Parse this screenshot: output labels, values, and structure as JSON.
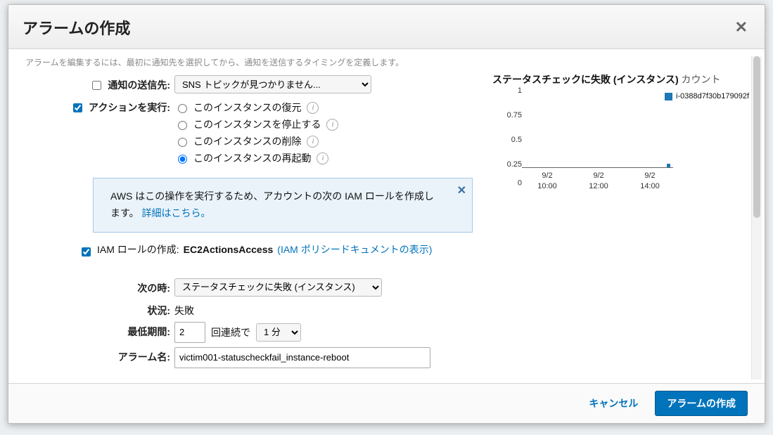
{
  "dialog": {
    "title": "アラームの作成",
    "intro": "アラームを編集するには、最初に通知先を選択してから、通知を送信するタイミングを定義します。"
  },
  "form": {
    "send_label": "通知の送信先:",
    "send_checked": false,
    "send_select": "SNS トピックが見つかりません...",
    "action_label": "アクションを実行:",
    "action_checked": true,
    "action_options": {
      "recover": "このインスタンスの復元",
      "stop": "このインスタンスを停止する",
      "delete": "このインスタンスの削除",
      "reboot": "このインスタンスの再起動"
    },
    "iam_notice": "AWS はこの操作を実行するため、アカウントの次の IAM ロールを作成します。",
    "iam_notice_link": "詳細はこちら。",
    "iam_row_label": "IAM ロールの作成:",
    "iam_role_name": "EC2ActionsAccess",
    "iam_policy_link": "(IAM ポリシードキュメントの表示)",
    "when_label": "次の時:",
    "when_select": "ステータスチェックに失敗 (インスタンス)",
    "status_label": "状況:",
    "status_value": "失敗",
    "min_period_label": "最低期間:",
    "min_period_value": "2",
    "min_period_mid": "回連続で",
    "min_period_select": "1 分",
    "alarm_name_label": "アラーム名:",
    "alarm_name_value": "victim001-statuscheckfail_instance-reboot"
  },
  "chart_data": {
    "type": "bar",
    "title_main": "ステータスチェックに失敗 (インスタンス)",
    "title_sub": "カウント",
    "legend": "i-0388d7f30b179092f",
    "yticks": [
      "1",
      "0.75",
      "0.5",
      "0.25",
      "0"
    ],
    "ylim": [
      0,
      1
    ],
    "xticks": [
      {
        "top": "9/2",
        "bottom": "10:00"
      },
      {
        "top": "9/2",
        "bottom": "12:00"
      },
      {
        "top": "9/2",
        "bottom": "14:00"
      }
    ],
    "series": [
      {
        "name": "i-0388d7f30b179092f",
        "x": "9/2 14:40",
        "value": 0.05
      }
    ]
  },
  "footer": {
    "cancel": "キャンセル",
    "create": "アラームの作成"
  },
  "icons": {
    "info": "i",
    "close": "✕"
  }
}
